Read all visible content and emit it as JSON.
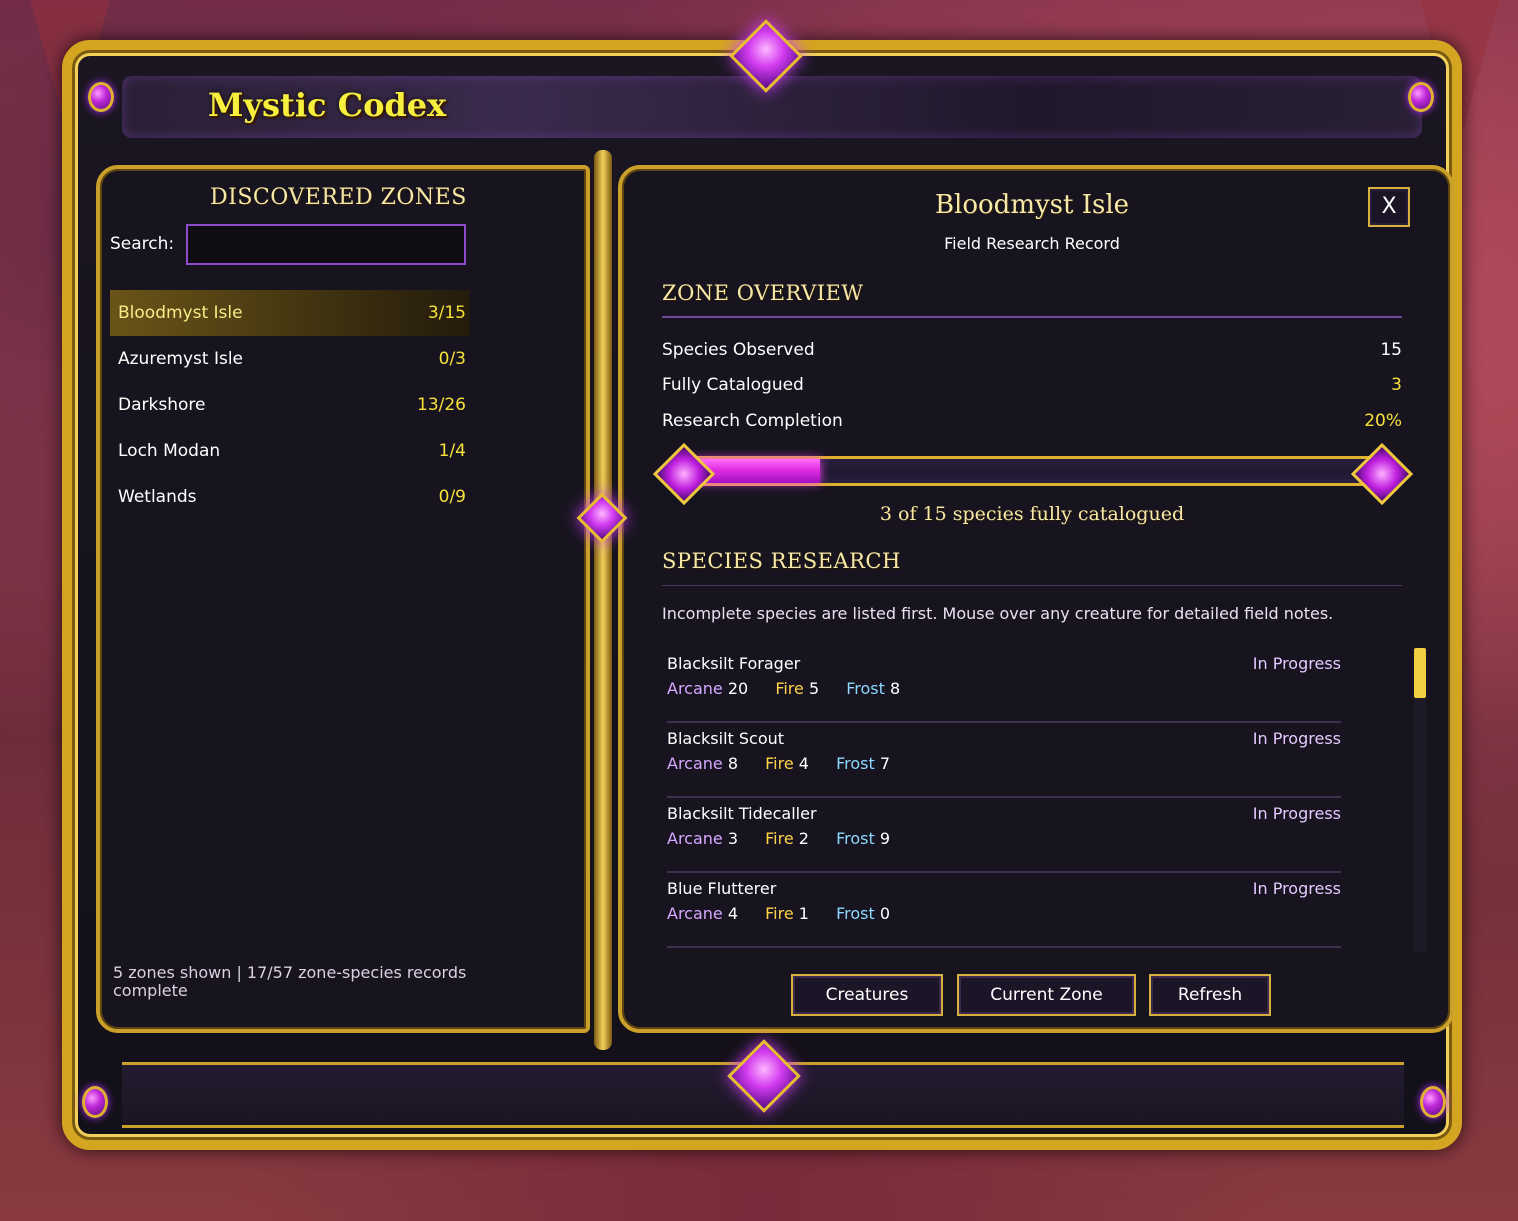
{
  "window": {
    "title": "Mystic Codex"
  },
  "left": {
    "heading": "DISCOVERED ZONES",
    "search_label": "Search:",
    "search_value": "",
    "zones": [
      {
        "name": "Bloodmyst Isle",
        "count": "3/15",
        "selected": true
      },
      {
        "name": "Azuremyst Isle",
        "count": "0/3",
        "selected": false
      },
      {
        "name": "Darkshore",
        "count": "13/26",
        "selected": false
      },
      {
        "name": "Loch Modan",
        "count": "1/4",
        "selected": false
      },
      {
        "name": "Wetlands",
        "count": "0/9",
        "selected": false
      }
    ],
    "footer": "5 zones shown  |  17/57 zone-species records complete"
  },
  "right": {
    "zone_title": "Bloodmyst Isle",
    "subtitle": "Field Research Record",
    "close_label": "X",
    "overview_heading": "ZONE OVERVIEW",
    "stats": [
      {
        "label": "Species Observed",
        "value": "15"
      },
      {
        "label": "Fully Catalogued",
        "value": "3"
      },
      {
        "label": "Research Completion",
        "value": "20%"
      }
    ],
    "progress": {
      "fraction": 0.2,
      "caption": "3 of 15 species fully catalogued"
    },
    "species_heading": "SPECIES RESEARCH",
    "species_note": "Incomplete species are listed first. Mouse over any creature for detailed field notes.",
    "species": [
      {
        "name": "Blacksilt Forager",
        "status": "In Progress",
        "arcane_label": "Arcane",
        "arcane": "20",
        "fire_label": "Fire",
        "fire": "5",
        "frost_label": "Frost",
        "frost": "8"
      },
      {
        "name": "Blacksilt Scout",
        "status": "In Progress",
        "arcane_label": "Arcane",
        "arcane": "8",
        "fire_label": "Fire",
        "fire": "4",
        "frost_label": "Frost",
        "frost": "7"
      },
      {
        "name": "Blacksilt Tidecaller",
        "status": "In Progress",
        "arcane_label": "Arcane",
        "arcane": "3",
        "fire_label": "Fire",
        "fire": "2",
        "frost_label": "Frost",
        "frost": "9"
      },
      {
        "name": "Blue Flutterer",
        "status": "In Progress",
        "arcane_label": "Arcane",
        "arcane": "4",
        "fire_label": "Fire",
        "fire": "1",
        "frost_label": "Frost",
        "frost": "0"
      }
    ],
    "buttons": {
      "creatures": "Creatures",
      "current_zone": "Current Zone",
      "refresh": "Refresh"
    }
  },
  "colors": {
    "gold": "#f7e23a",
    "title_yellow": "#f7ef3d",
    "frame_gold": "#d4a520",
    "arcane": "#d6a8ff",
    "fire": "#ffd24a",
    "frost": "#8ed8ff",
    "progress_magenta": "#e02ee0"
  }
}
